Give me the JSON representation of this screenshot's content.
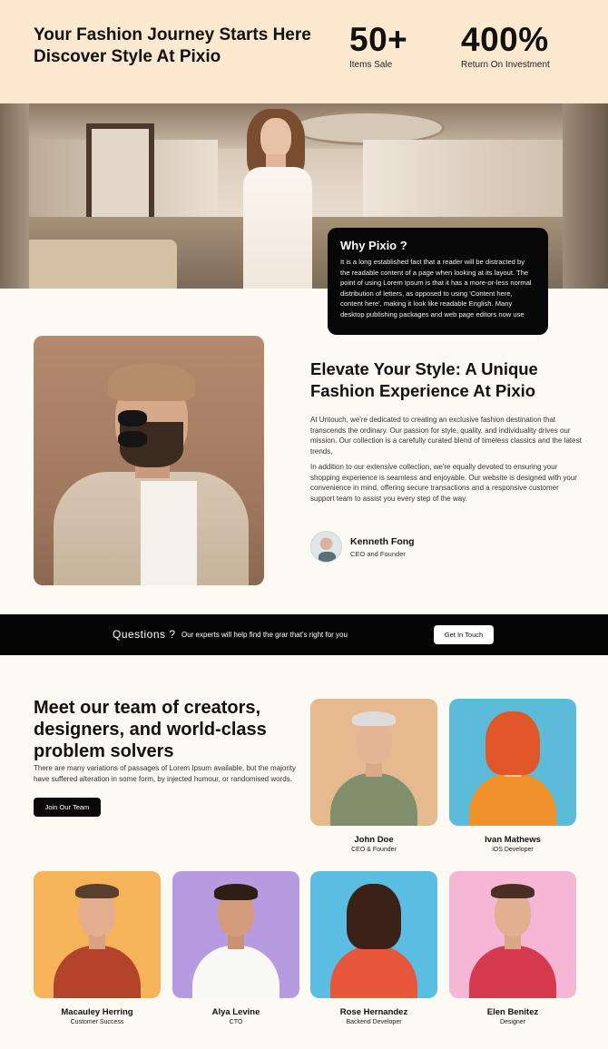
{
  "hero": {
    "title_line1": "Your Fashion Journey Starts Here",
    "title_line2": "Discover Style At Pixio",
    "stats": [
      {
        "value": "50+",
        "label": "Items Sale"
      },
      {
        "value": "400%",
        "label": "Return On Investment"
      }
    ]
  },
  "why": {
    "title": "Why Pixio ?",
    "text": "It is a long established fact that a reader will be distracted by the readable content of a page when looking at its layout. The point of using Lorem Ipsum is that it has a more-or-less normal distribution of letters, as opposed to using 'Content here, content here', making it look like readable English. Many desktop publishing packages and web page editors now use"
  },
  "about": {
    "title": "Elevate Your Style: A Unique Fashion Experience At Pixio",
    "paragraph1": "At Untouch, we're dedicated to creating an exclusive fashion destination that transcends the ordinary. Our passion for style, quality, and individuality drives our mission. Our collection is a carefully curated blend of timeless classics and the latest trends,",
    "paragraph2": "In addition to our extensive collection, we're equally devoted to ensuring your shopping experience is seamless and enjoyable. Our website is designed with your convenience in mind, offering secure transactions and a responsive customer support team to assist you every step of the way.",
    "author_name": "Kenneth Fong",
    "author_role": "CEO and Founder"
  },
  "questions": {
    "title": "Questions ?",
    "text": "Our experts will help find the grar that's right for you",
    "button": "Get In Touch"
  },
  "team": {
    "title": "Meet our team of creators, designers, and world-class problem solvers",
    "description": "There are many variations of passages of Lorem Ipsum available, but the majority have suffered alteration in some form, by injected humour, or randomised words.",
    "button": "Join Our Team",
    "members": [
      {
        "name": "John Doe",
        "role": "CEO & Founder",
        "bg": "#e7b98f"
      },
      {
        "name": "Ivan Mathews",
        "role": "iOS Developer",
        "bg": "#5bbbd8"
      },
      {
        "name": "Macauley Herring",
        "role": "Customer Success",
        "bg": "#f7b35a"
      },
      {
        "name": "Alya Levine",
        "role": "CTO",
        "bg": "#b79be0"
      },
      {
        "name": "Rose Hernandez",
        "role": "Backend Developer",
        "bg": "#5cbde3"
      },
      {
        "name": "Elen Benitez",
        "role": "Designer",
        "bg": "#f6b6d6"
      }
    ]
  }
}
